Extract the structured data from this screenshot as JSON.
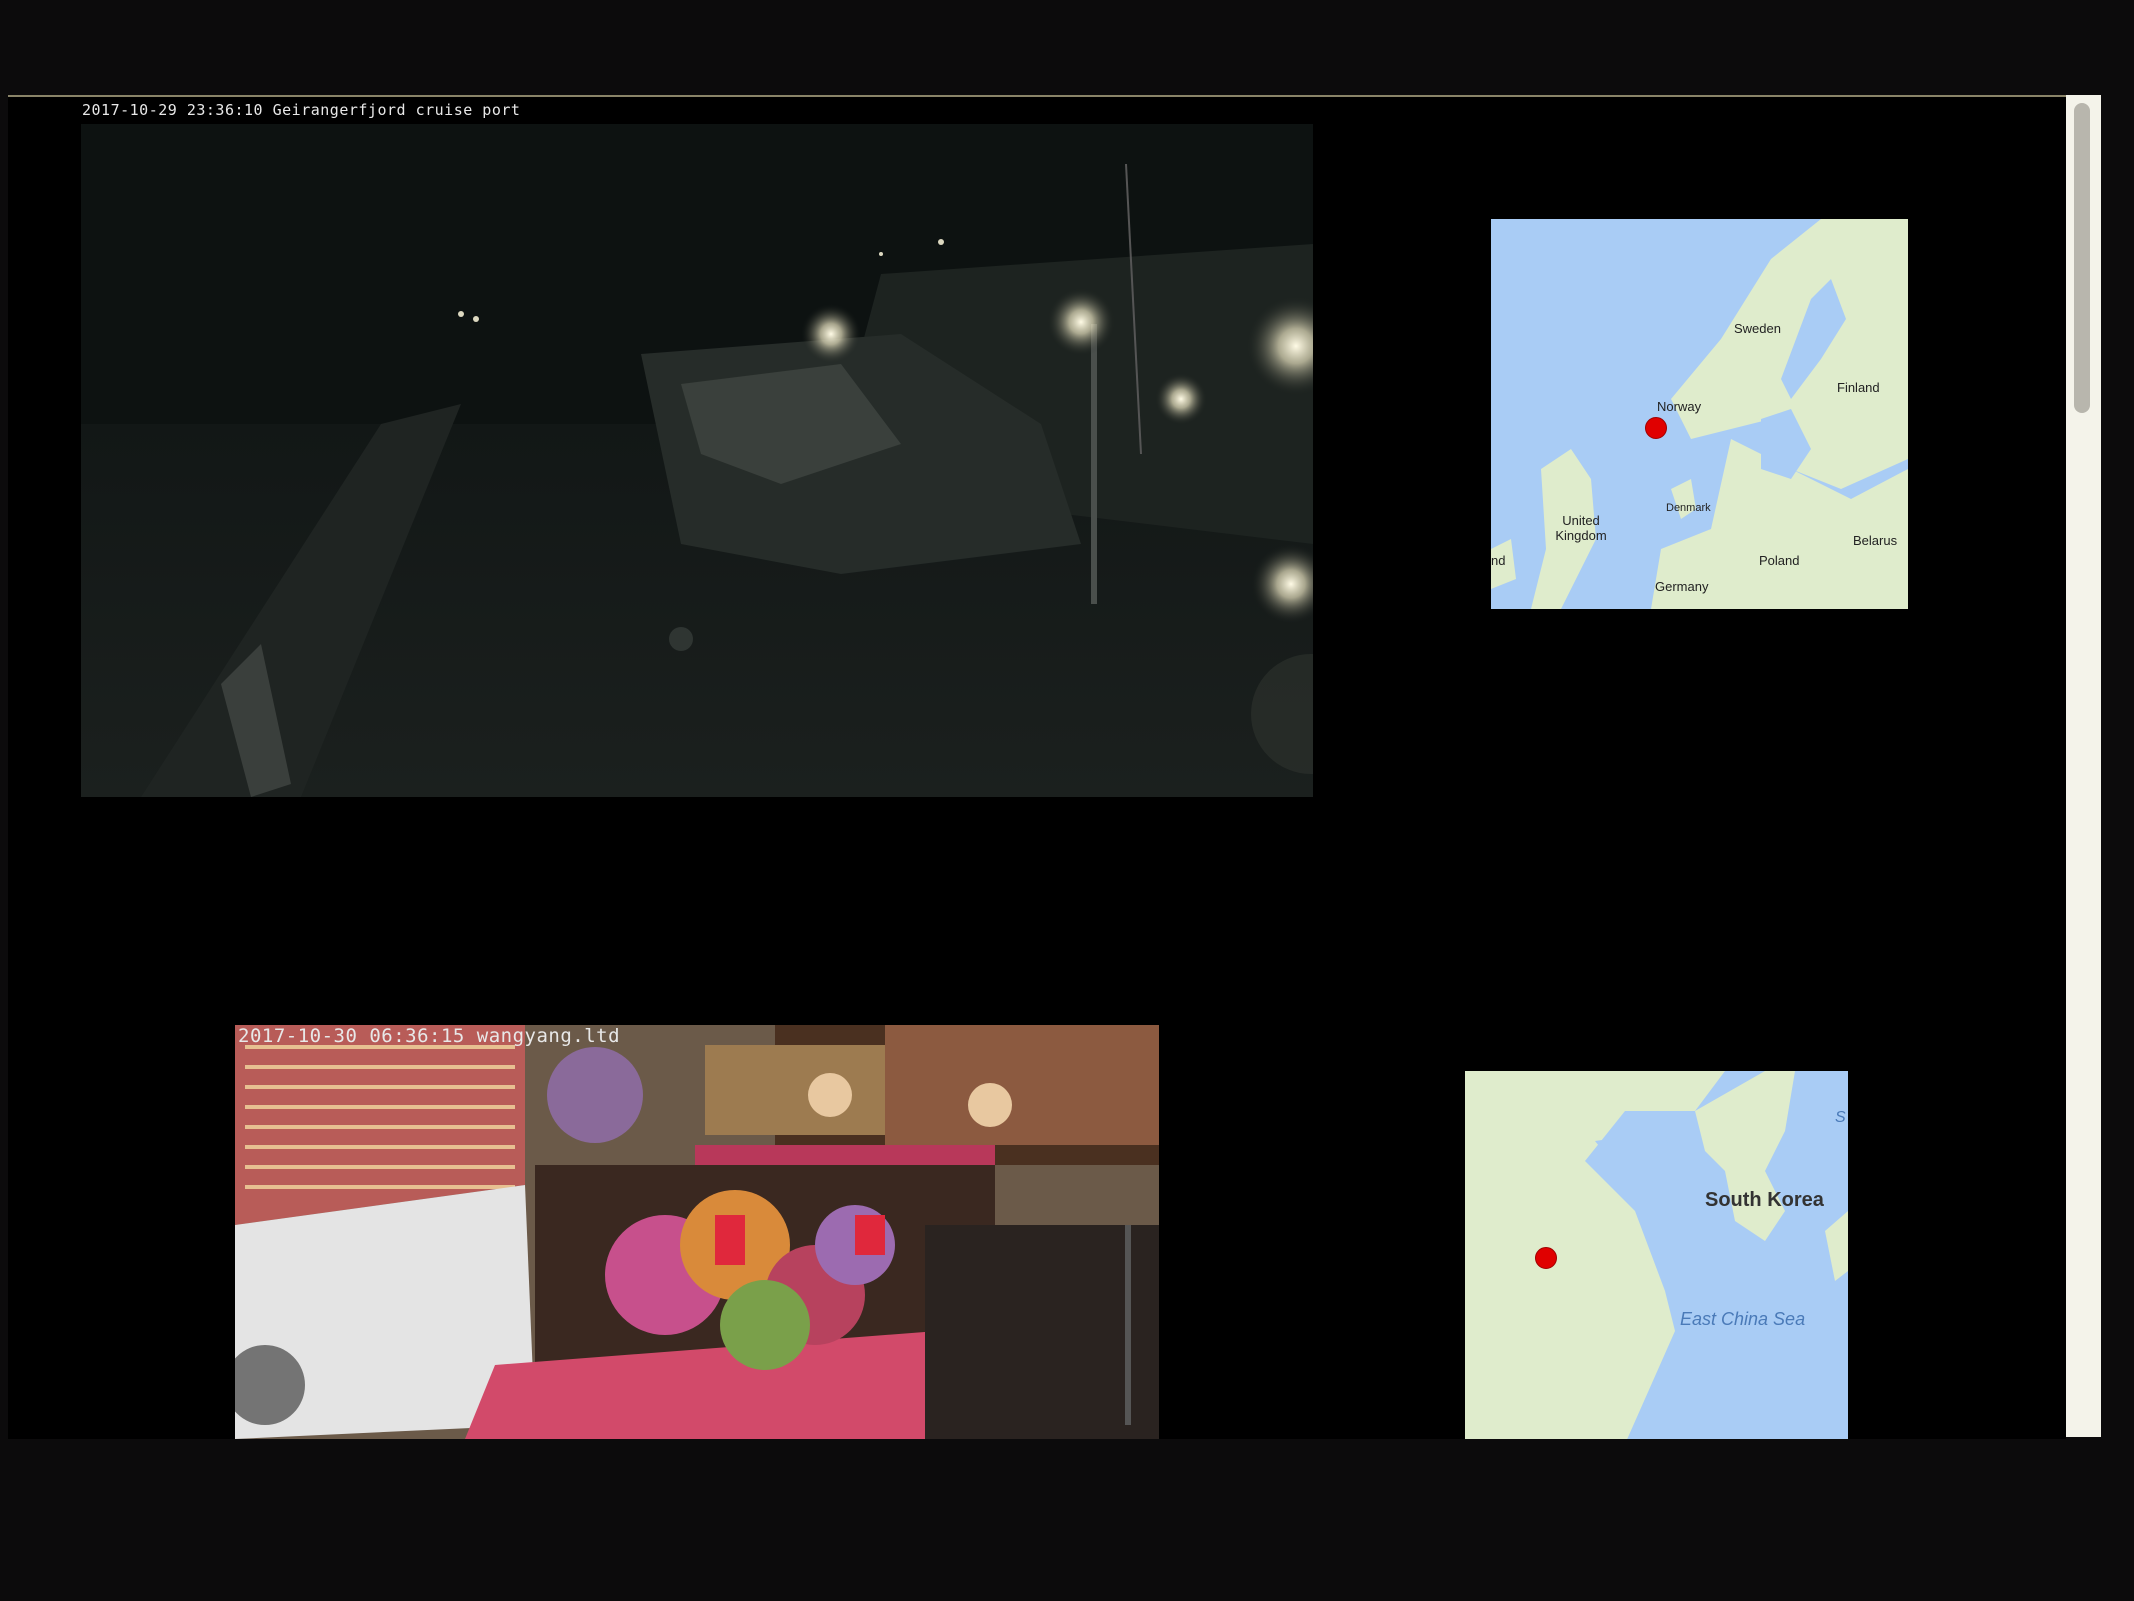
{
  "cameras": [
    {
      "stamp": "2017-10-29 23:36:10 Geirangerfjord cruise port"
    },
    {
      "stamp": "2017-10-30 06:36:15 wangyang.ltd"
    }
  ],
  "maps": [
    {
      "labels": {
        "sweden": "Sweden",
        "finland": "Finland",
        "norway": "Norway",
        "uk": "United Kingdom",
        "denmark": "Denmark",
        "belarus": "Belarus",
        "poland": "Poland",
        "germany": "Germany",
        "ireland_fragment": "nd"
      }
    },
    {
      "labels": {
        "south_korea": "South Korea",
        "east_china_sea": "East China Sea",
        "sea_fragment": "S"
      }
    }
  ],
  "colors": {
    "water": "#a9ccf5",
    "land": "#dfeccc",
    "pin": "#e00000"
  }
}
